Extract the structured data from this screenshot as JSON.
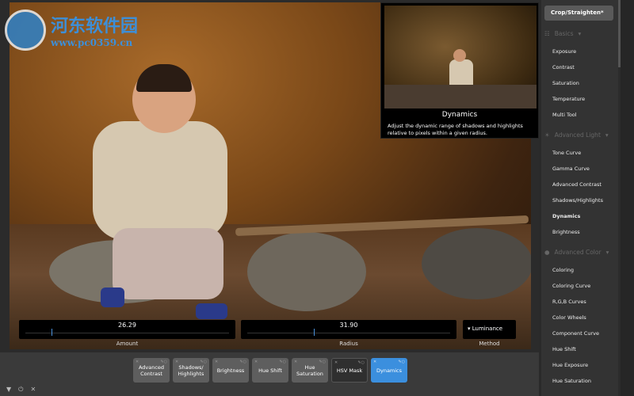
{
  "watermark": {
    "title": "河东软件园",
    "url": "www.pc0359.cn"
  },
  "tooltip": {
    "title": "Dynamics",
    "description": "Adjust the dynamic range of shadows and highlights relative to pixels within a given radius."
  },
  "sliders": [
    {
      "label": "Amount",
      "value": "26.29",
      "fraction": 0.13
    },
    {
      "label": "Radius",
      "value": "31.90",
      "fraction": 0.33
    }
  ],
  "method": {
    "label": "Method",
    "value": "Luminance"
  },
  "nodes": [
    {
      "label": "Advanced Contrast"
    },
    {
      "label": "Shadows/ Highlights"
    },
    {
      "label": "Brightness"
    },
    {
      "label": "Hue Shift"
    },
    {
      "label": "Hue Saturation"
    },
    {
      "label": "HSV Mask"
    },
    {
      "label": "Dynamics"
    }
  ],
  "bottom_icons": [
    "filter-icon",
    "power-icon",
    "close-icon"
  ],
  "sidebar": {
    "top_button": "Crop/Straighten*",
    "sections": [
      {
        "title": "Basics",
        "items": [
          "Exposure",
          "Contrast",
          "Saturation",
          "Temperature",
          "Multi Tool"
        ]
      },
      {
        "title": "Advanced Light",
        "items": [
          "Tone Curve",
          "Gamma Curve",
          "Advanced Contrast",
          "Shadows/Highlights",
          "Dynamics",
          "Brightness"
        ]
      },
      {
        "title": "Advanced Color",
        "items": [
          "Coloring",
          "Coloring Curve",
          "R,G,B Curves",
          "Color Wheels",
          "Component Curve",
          "Hue Shift",
          "Hue Exposure",
          "Hue Saturation"
        ]
      }
    ],
    "selected": "Dynamics"
  },
  "colors": {
    "accent": "#3b8fde"
  }
}
